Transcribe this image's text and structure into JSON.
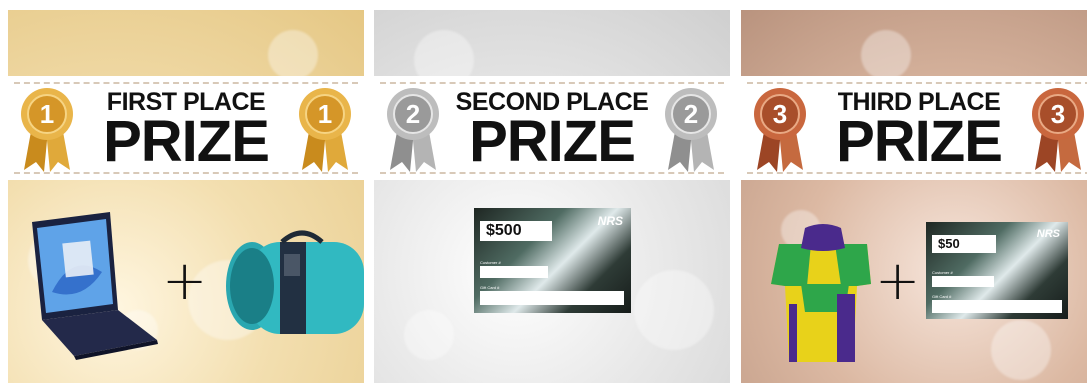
{
  "prizes": [
    {
      "line1": "FIRST PLACE",
      "line2": "PRIZE",
      "rank": "1"
    },
    {
      "line1": "SECOND PLACE",
      "line2": "PRIZE",
      "rank": "2"
    },
    {
      "line1": "THIRD PLACE",
      "line2": "PRIZE",
      "rank": "3"
    }
  ],
  "cards": {
    "second": {
      "amount": "$500",
      "logo": "NRS",
      "customer_label": "Customer #",
      "gift_label": "Gift Card #"
    },
    "third": {
      "amount": "$50",
      "logo": "NRS",
      "customer_label": "Customer #",
      "gift_label": "Gift Card #"
    }
  },
  "colors": {
    "gold": "#d9a441",
    "silver": "#a6a6a6",
    "bronze": "#b4562f"
  }
}
